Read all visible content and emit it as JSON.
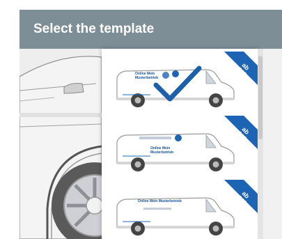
{
  "panel": {
    "title": "Select the template"
  },
  "templates": [
    {
      "name": "template-1",
      "selected": true,
      "price": "€49,-",
      "price_prefix": "ab",
      "van_text": "Online Mein Musterbetrieb"
    },
    {
      "name": "template-2",
      "selected": false,
      "price": "€49,-",
      "price_prefix": "ab",
      "van_text": "Online Mein Musterbetrieb"
    },
    {
      "name": "template-3",
      "selected": false,
      "price": "€49,-",
      "price_prefix": "ab",
      "van_text": "Online Mein Musterbetrieb"
    }
  ],
  "colors": {
    "header_bg": "#7d8e96",
    "accent_blue": "#1e64b4",
    "checkmark": "#1e5faa",
    "ribbon": "#1e64b4"
  },
  "icons": {
    "selected": "checkmark-icon",
    "price_ribbon": "price-ribbon-icon",
    "van": "van-icon"
  }
}
